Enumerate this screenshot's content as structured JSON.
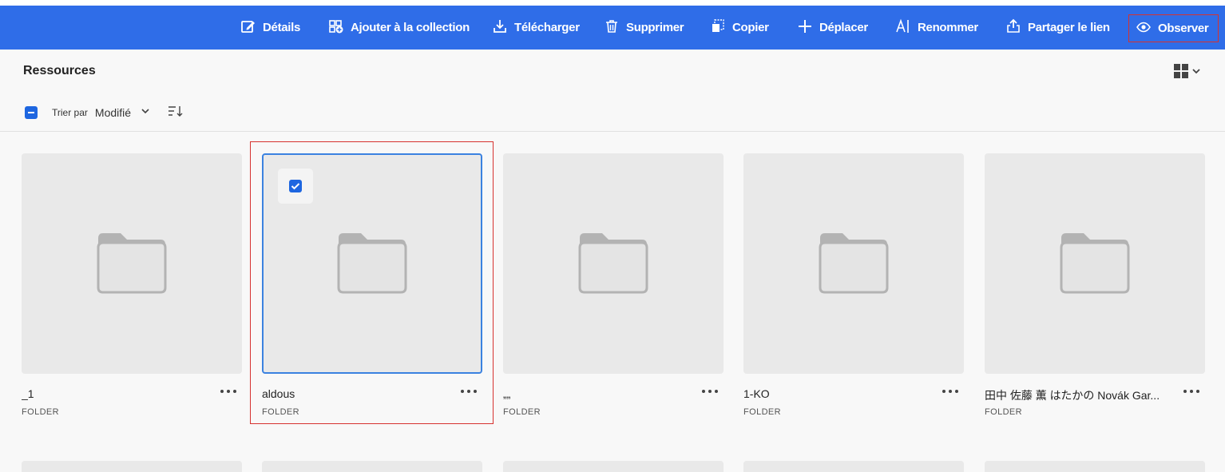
{
  "toolbar": {
    "actions": [
      {
        "label": "Détails",
        "icon": "edit-icon"
      },
      {
        "label": "Ajouter à la collection",
        "icon": "add-to-collection-icon"
      },
      {
        "label": "Télécharger",
        "icon": "download-icon"
      },
      {
        "label": "Supprimer",
        "icon": "trash-icon"
      },
      {
        "label": "Copier",
        "icon": "copy-icon"
      },
      {
        "label": "Déplacer",
        "icon": "move-icon"
      },
      {
        "label": "Renommer",
        "icon": "rename-icon"
      },
      {
        "label": "Partager le lien",
        "icon": "share-link-icon"
      },
      {
        "label": "Observer",
        "icon": "eye-icon"
      }
    ],
    "background": "#2f6de8"
  },
  "page": {
    "title": "Ressources",
    "view_icon": "grid-view-icon"
  },
  "sort": {
    "label": "Trier par",
    "value": "Modifié"
  },
  "cards": [
    {
      "name": "_1",
      "type": "FOLDER",
      "selected": false
    },
    {
      "name": "aldous",
      "type": "FOLDER",
      "selected": true
    },
    {
      "name": "„„",
      "type": "FOLDER",
      "selected": false
    },
    {
      "name": "1-KO",
      "type": "FOLDER",
      "selected": false
    },
    {
      "name": "田中 佐藤 薫 はたかの Novák Gar...",
      "type": "FOLDER",
      "selected": false
    }
  ],
  "colors": {
    "accent": "#1e66e0",
    "selection_outline": "#d6322f",
    "thumbnail_bg": "#e9e9e9"
  }
}
